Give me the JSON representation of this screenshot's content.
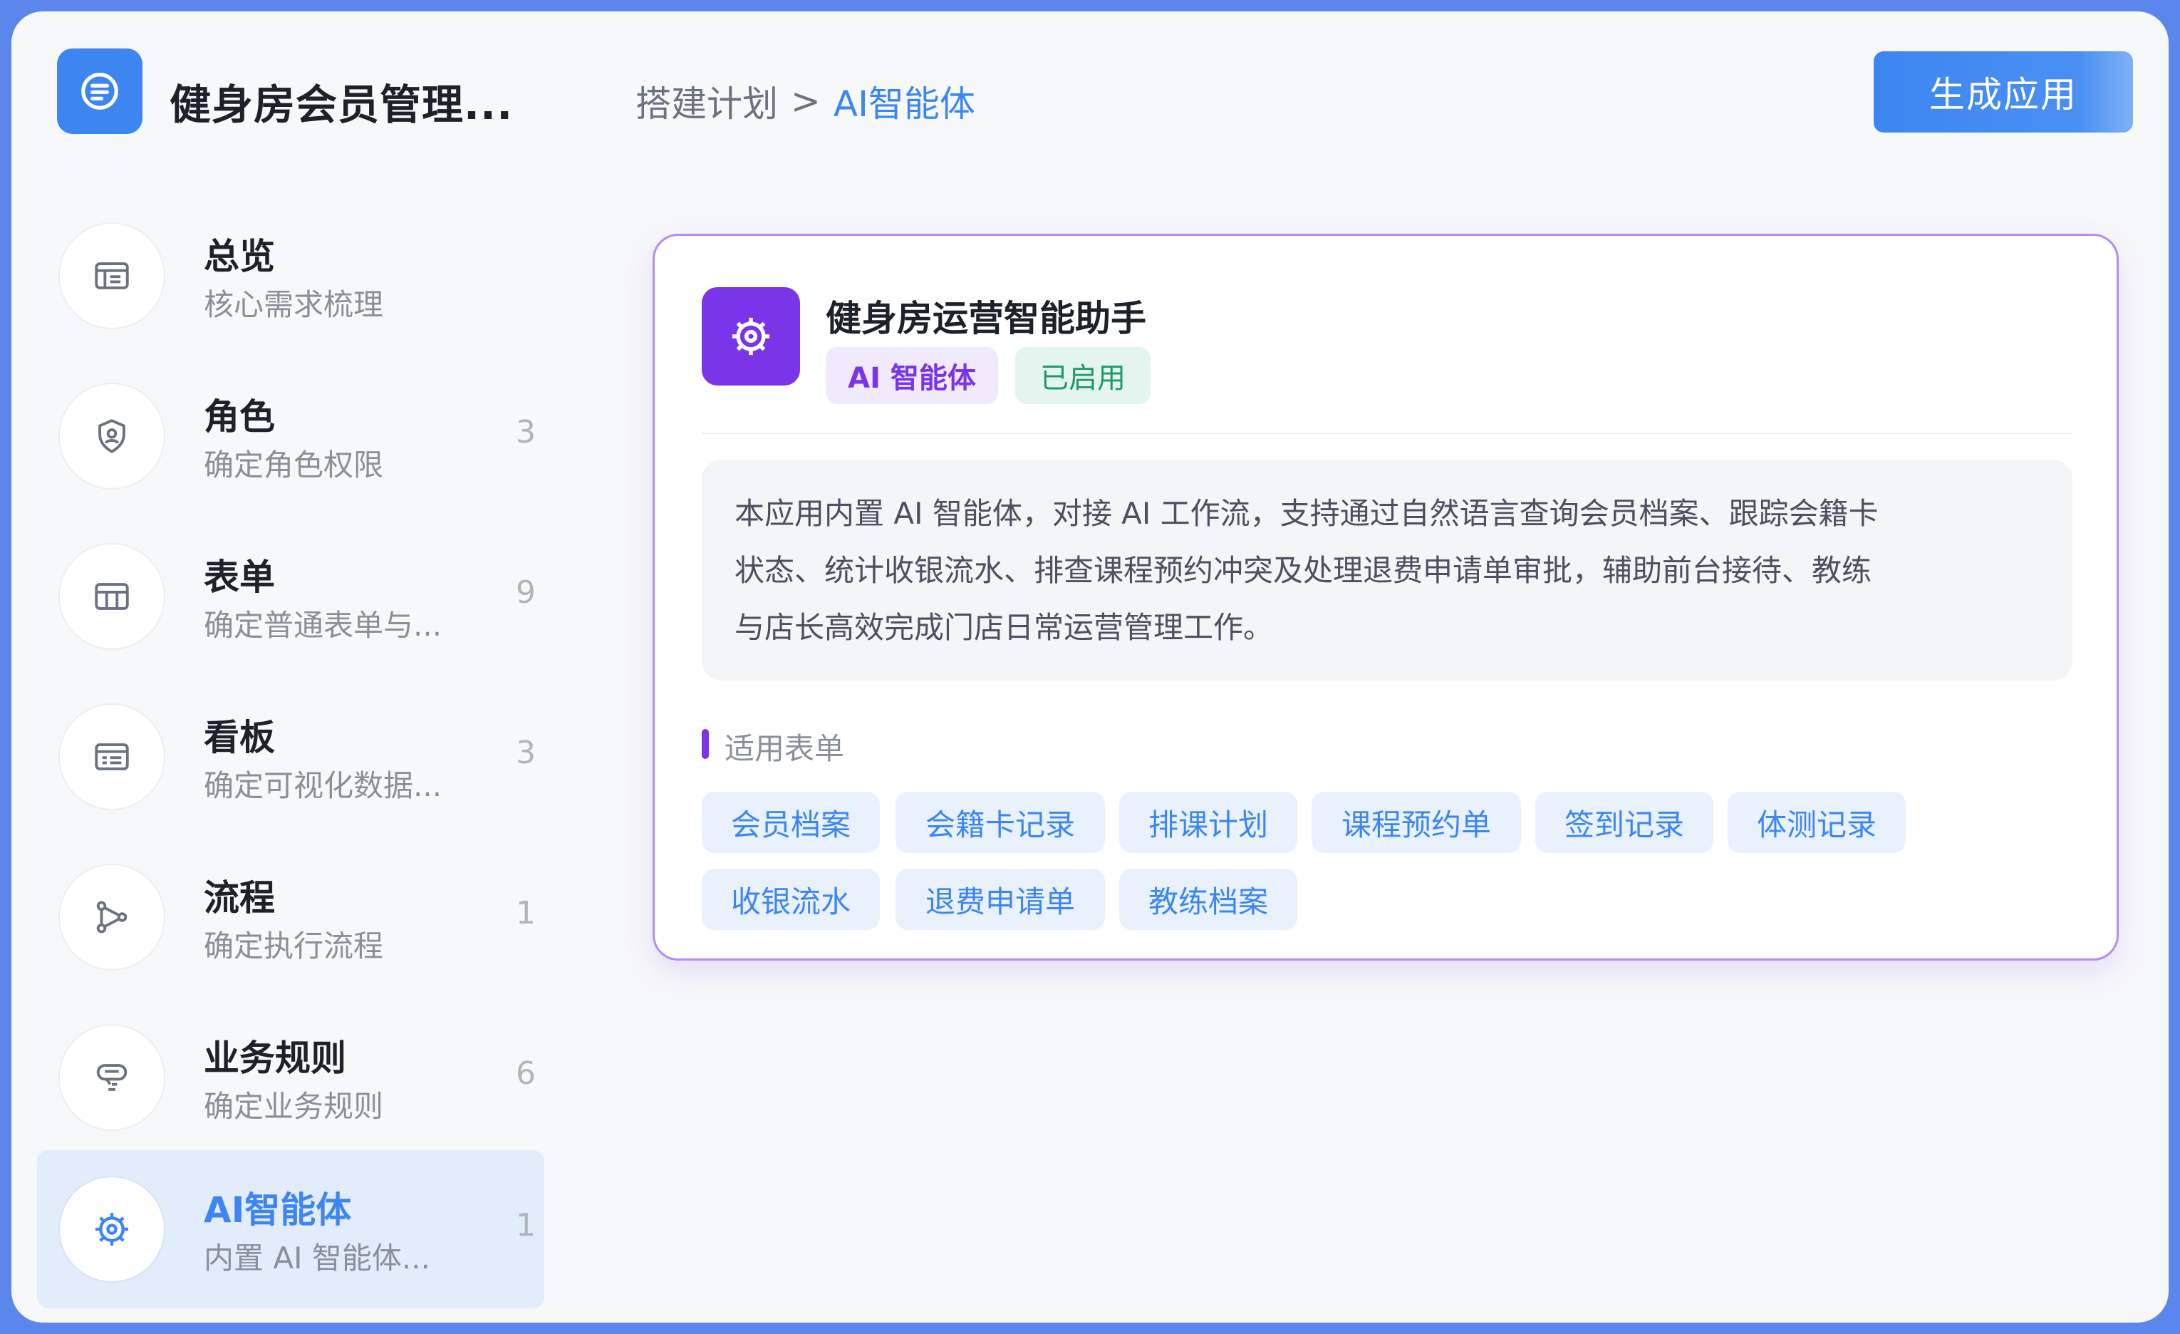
{
  "header": {
    "app_title": "健身房会员管理...",
    "breadcrumb": {
      "parent": "搭建计划",
      "separator": ">",
      "current": "AI智能体"
    },
    "generate_button": "生成应用"
  },
  "sidebar": {
    "items": [
      {
        "title": "总览",
        "subtitle": "核心需求梳理",
        "count": "",
        "icon": "overview-icon"
      },
      {
        "title": "角色",
        "subtitle": "确定角色权限",
        "count": "3",
        "icon": "shield-user-icon"
      },
      {
        "title": "表单",
        "subtitle": "确定普通表单与...",
        "count": "9",
        "icon": "table-icon"
      },
      {
        "title": "看板",
        "subtitle": "确定可视化数据...",
        "count": "3",
        "icon": "dashboard-icon"
      },
      {
        "title": "流程",
        "subtitle": "确定执行流程",
        "count": "1",
        "icon": "flow-icon"
      },
      {
        "title": "业务规则",
        "subtitle": "确定业务规则",
        "count": "6",
        "icon": "rule-icon"
      },
      {
        "title": "AI智能体",
        "subtitle": "内置 AI 智能体...",
        "count": "1",
        "icon": "ai-gear-icon",
        "active": true
      }
    ]
  },
  "agent_card": {
    "name": "健身房运营智能助手",
    "tag_type": "AI 智能体",
    "tag_status": "已启用",
    "description_lines": [
      "本应用内置 AI 智能体，对接 AI 工作流，支持通过自然语言查询会员档案、跟踪会籍卡",
      "状态、统计收银流水、排查课程预约冲突及处理退费申请单审批，辅助前台接待、教练",
      "与店长高效完成门店日常运营管理工作。"
    ],
    "forms_section_title": "适用表单",
    "forms": [
      "会员档案",
      "会籍卡记录",
      "排课计划",
      "课程预约单",
      "签到记录",
      "体测记录",
      "收银流水",
      "退费申请单",
      "教练档案"
    ]
  },
  "colors": {
    "primary": "#3d86f2",
    "ai_purple": "#7a35e8",
    "enabled_green": "#1f9a6a",
    "frame_border": "#5b86ec"
  }
}
